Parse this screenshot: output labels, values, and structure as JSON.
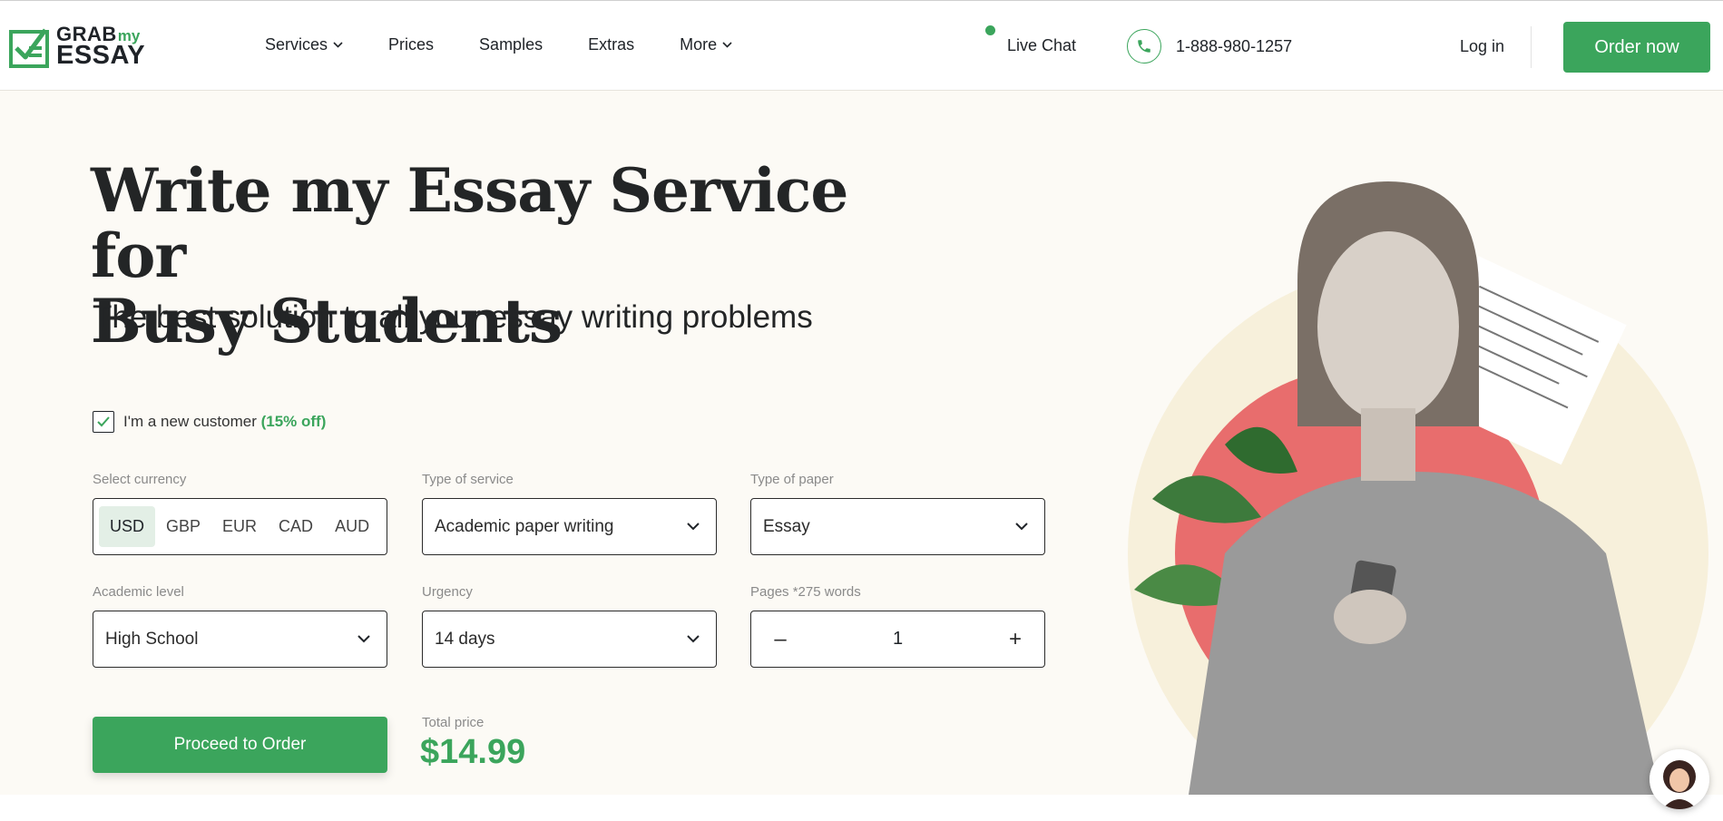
{
  "logo": {
    "grab": "GRAB",
    "my": "my",
    "essay": "ESSAY"
  },
  "nav": {
    "items": [
      {
        "label": "Services",
        "has_dropdown": true
      },
      {
        "label": "Prices",
        "has_dropdown": false
      },
      {
        "label": "Samples",
        "has_dropdown": false
      },
      {
        "label": "Extras",
        "has_dropdown": false
      },
      {
        "label": "More",
        "has_dropdown": true
      }
    ]
  },
  "header": {
    "live_chat": "Live Chat",
    "phone": "1-888-980-1257",
    "login": "Log in",
    "order_now": "Order now"
  },
  "hero": {
    "title_line1": "Write my Essay Service for",
    "title_line2": "Busy Students",
    "subtitle": "The best solution to all your essay writing problems"
  },
  "form": {
    "new_customer_checked": true,
    "new_customer_label": "I'm a new customer",
    "new_customer_discount": "(15% off)",
    "currency_label": "Select currency",
    "currencies": [
      "USD",
      "GBP",
      "EUR",
      "CAD",
      "AUD"
    ],
    "selected_currency": "USD",
    "service_label": "Type of service",
    "service_value": "Academic paper writing",
    "paper_label": "Type of paper",
    "paper_value": "Essay",
    "level_label": "Academic level",
    "level_value": "High School",
    "urgency_label": "Urgency",
    "urgency_value": "14 days",
    "pages_label": "Pages *275 words",
    "pages_value": "1",
    "minus": "–",
    "plus": "+",
    "proceed": "Proceed to Order",
    "total_label": "Total price",
    "total_price": "$14.99"
  },
  "colors": {
    "accent": "#3ba55c",
    "background": "#fcfaf5",
    "text": "#1f2328"
  },
  "icons": {
    "chevron": "chevron-down-icon",
    "phone": "phone-icon",
    "check": "check-icon",
    "chat": "chat-avatar-icon"
  }
}
